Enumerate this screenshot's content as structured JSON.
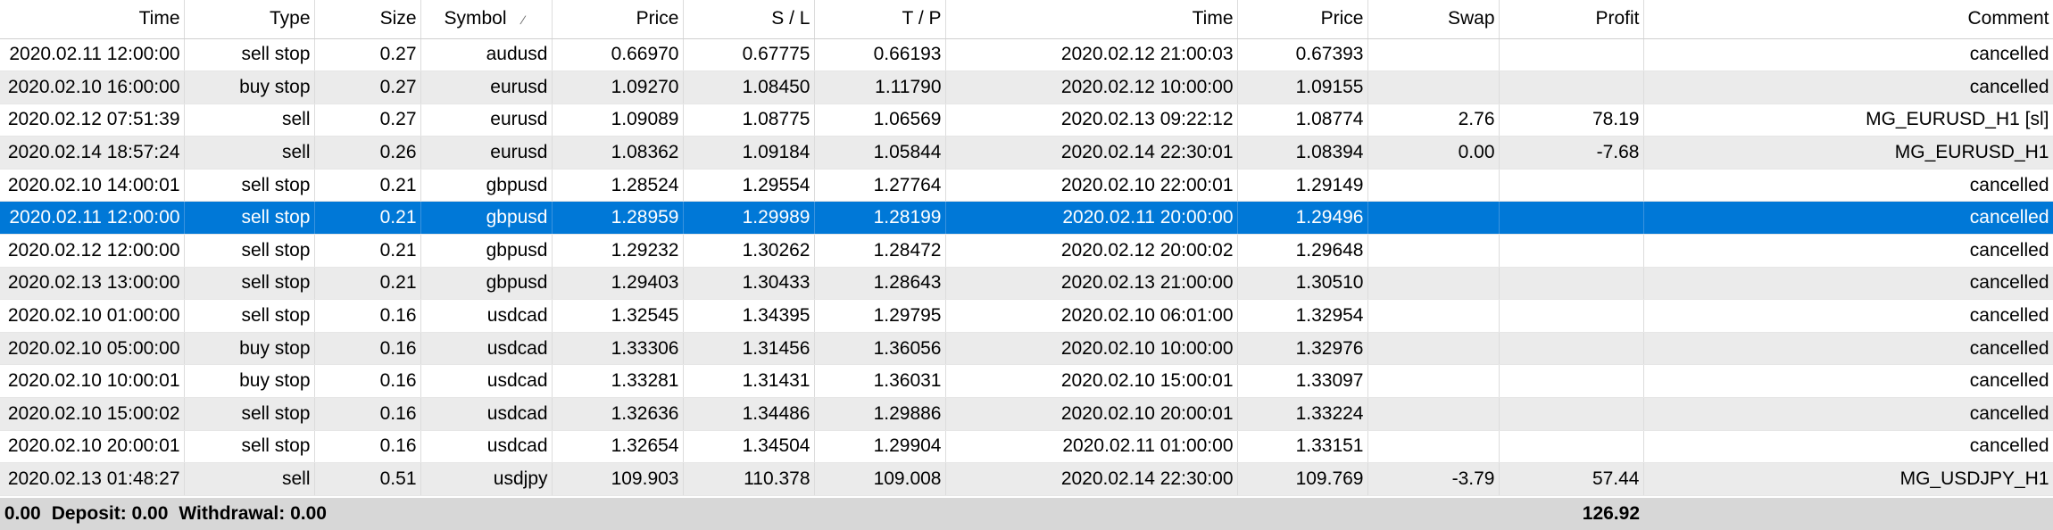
{
  "columns": [
    "Time",
    "Type",
    "Size",
    "Symbol",
    "Price",
    "S / L",
    "T / P",
    "Time",
    "Price",
    "Swap",
    "Profit",
    "Comment"
  ],
  "rows": [
    {
      "open_time": "2020.02.11 12:00:00",
      "type": "sell stop",
      "size": "0.27",
      "symbol": "audusd",
      "price": "0.66970",
      "sl": "0.67775",
      "tp": "0.66193",
      "close_time": "2020.02.12 21:00:03",
      "close_price": "0.67393",
      "swap": "",
      "profit": "",
      "comment": "cancelled"
    },
    {
      "open_time": "2020.02.10 16:00:00",
      "type": "buy stop",
      "size": "0.27",
      "symbol": "eurusd",
      "price": "1.09270",
      "sl": "1.08450",
      "tp": "1.11790",
      "close_time": "2020.02.12 10:00:00",
      "close_price": "1.09155",
      "swap": "",
      "profit": "",
      "comment": "cancelled"
    },
    {
      "open_time": "2020.02.12 07:51:39",
      "type": "sell",
      "size": "0.27",
      "symbol": "eurusd",
      "price": "1.09089",
      "sl": "1.08775",
      "tp": "1.06569",
      "close_time": "2020.02.13 09:22:12",
      "close_price": "1.08774",
      "swap": "2.76",
      "profit": "78.19",
      "comment": "MG_EURUSD_H1 [sl]"
    },
    {
      "open_time": "2020.02.14 18:57:24",
      "type": "sell",
      "size": "0.26",
      "symbol": "eurusd",
      "price": "1.08362",
      "sl": "1.09184",
      "tp": "1.05844",
      "close_time": "2020.02.14 22:30:01",
      "close_price": "1.08394",
      "swap": "0.00",
      "profit": "-7.68",
      "comment": "MG_EURUSD_H1"
    },
    {
      "open_time": "2020.02.10 14:00:01",
      "type": "sell stop",
      "size": "0.21",
      "symbol": "gbpusd",
      "price": "1.28524",
      "sl": "1.29554",
      "tp": "1.27764",
      "close_time": "2020.02.10 22:00:01",
      "close_price": "1.29149",
      "swap": "",
      "profit": "",
      "comment": "cancelled"
    },
    {
      "open_time": "2020.02.11 12:00:00",
      "type": "sell stop",
      "size": "0.21",
      "symbol": "gbpusd",
      "price": "1.28959",
      "sl": "1.29989",
      "tp": "1.28199",
      "close_time": "2020.02.11 20:00:00",
      "close_price": "1.29496",
      "swap": "",
      "profit": "",
      "comment": "cancelled",
      "selected": true
    },
    {
      "open_time": "2020.02.12 12:00:00",
      "type": "sell stop",
      "size": "0.21",
      "symbol": "gbpusd",
      "price": "1.29232",
      "sl": "1.30262",
      "tp": "1.28472",
      "close_time": "2020.02.12 20:00:02",
      "close_price": "1.29648",
      "swap": "",
      "profit": "",
      "comment": "cancelled"
    },
    {
      "open_time": "2020.02.13 13:00:00",
      "type": "sell stop",
      "size": "0.21",
      "symbol": "gbpusd",
      "price": "1.29403",
      "sl": "1.30433",
      "tp": "1.28643",
      "close_time": "2020.02.13 21:00:00",
      "close_price": "1.30510",
      "swap": "",
      "profit": "",
      "comment": "cancelled"
    },
    {
      "open_time": "2020.02.10 01:00:00",
      "type": "sell stop",
      "size": "0.16",
      "symbol": "usdcad",
      "price": "1.32545",
      "sl": "1.34395",
      "tp": "1.29795",
      "close_time": "2020.02.10 06:01:00",
      "close_price": "1.32954",
      "swap": "",
      "profit": "",
      "comment": "cancelled"
    },
    {
      "open_time": "2020.02.10 05:00:00",
      "type": "buy stop",
      "size": "0.16",
      "symbol": "usdcad",
      "price": "1.33306",
      "sl": "1.31456",
      "tp": "1.36056",
      "close_time": "2020.02.10 10:00:00",
      "close_price": "1.32976",
      "swap": "",
      "profit": "",
      "comment": "cancelled"
    },
    {
      "open_time": "2020.02.10 10:00:01",
      "type": "buy stop",
      "size": "0.16",
      "symbol": "usdcad",
      "price": "1.33281",
      "sl": "1.31431",
      "tp": "1.36031",
      "close_time": "2020.02.10 15:00:01",
      "close_price": "1.33097",
      "swap": "",
      "profit": "",
      "comment": "cancelled"
    },
    {
      "open_time": "2020.02.10 15:00:02",
      "type": "sell stop",
      "size": "0.16",
      "symbol": "usdcad",
      "price": "1.32636",
      "sl": "1.34486",
      "tp": "1.29886",
      "close_time": "2020.02.10 20:00:01",
      "close_price": "1.33224",
      "swap": "",
      "profit": "",
      "comment": "cancelled"
    },
    {
      "open_time": "2020.02.10 20:00:01",
      "type": "sell stop",
      "size": "0.16",
      "symbol": "usdcad",
      "price": "1.32654",
      "sl": "1.34504",
      "tp": "1.29904",
      "close_time": "2020.02.11 01:00:00",
      "close_price": "1.33151",
      "swap": "",
      "profit": "",
      "comment": "cancelled"
    },
    {
      "open_time": "2020.02.13 01:48:27",
      "type": "sell",
      "size": "0.51",
      "symbol": "usdjpy",
      "price": "109.903",
      "sl": "110.378",
      "tp": "109.008",
      "close_time": "2020.02.14 22:30:00",
      "close_price": "109.769",
      "swap": "-3.79",
      "profit": "57.44",
      "comment": "MG_USDJPY_H1"
    }
  ],
  "footer": {
    "summary_prefix": ": 0.00",
    "deposit": "Deposit: 0.00",
    "withdrawal": "Withdrawal: 0.00",
    "total_profit": "126.92"
  },
  "colors": {
    "selected_row": "#0078d7",
    "stripe": "#ebebeb",
    "footer": "#d7d7d7"
  },
  "icons": {
    "symbol_sort": "sort-indicator-icon"
  }
}
